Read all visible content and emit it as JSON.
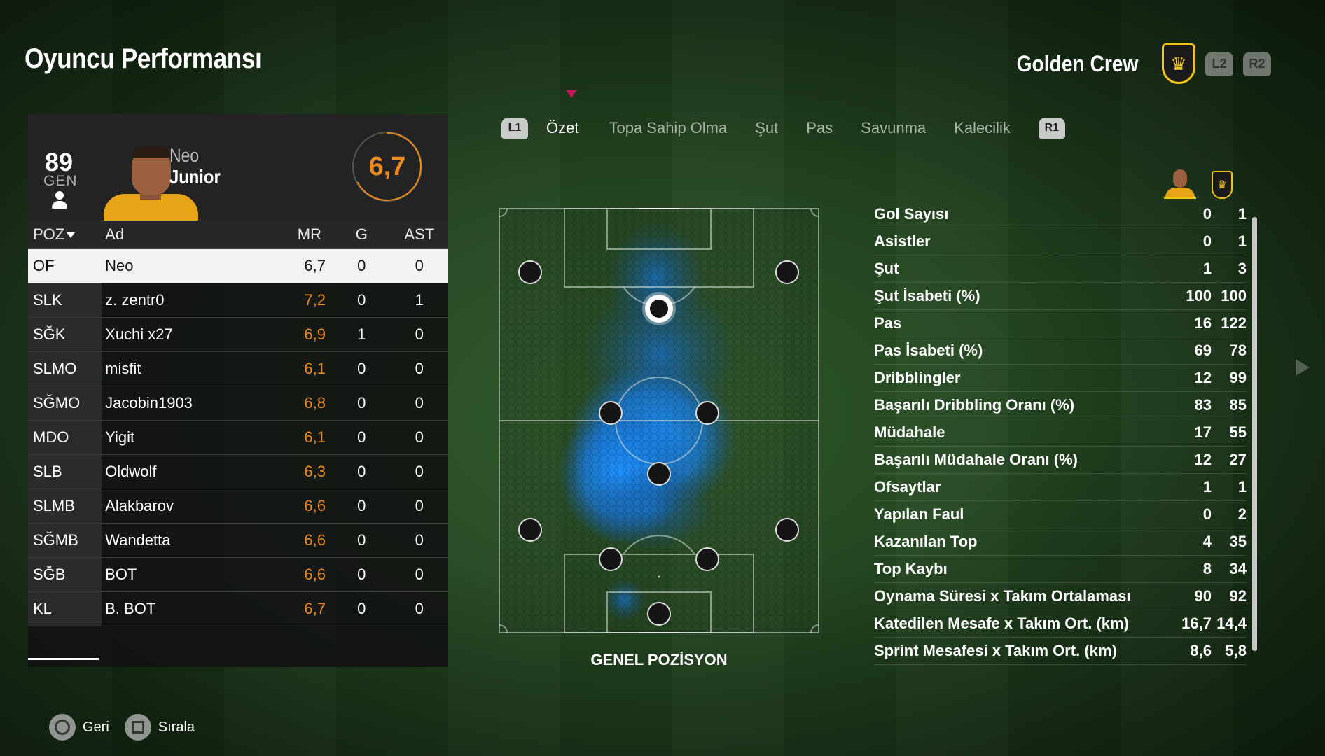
{
  "page": {
    "title": "Oyuncu Performansı"
  },
  "team": {
    "name": "Golden Crew",
    "crest_icon": "lion-crest-icon",
    "left_trigger": "L2",
    "right_trigger": "R2",
    "accent_color": "#f0c419"
  },
  "player_card": {
    "overall": "89",
    "overall_label": "GEN",
    "first_name": "Neo",
    "last_name": "Junior",
    "match_rating": "6,7",
    "match_rating_fraction": 0.67,
    "rating_color": "#f08a1a"
  },
  "table": {
    "columns": [
      "POZ",
      "Ad",
      "MR",
      "G",
      "AST"
    ],
    "rows": [
      {
        "pos": "OF",
        "name": "Neo",
        "mr": "6,7",
        "g": "0",
        "ast": "0",
        "selected": true
      },
      {
        "pos": "SLK",
        "name": "z. zentr0",
        "mr": "7,2",
        "g": "0",
        "ast": "1"
      },
      {
        "pos": "SĞK",
        "name": "Xuchi x27",
        "mr": "6,9",
        "g": "1",
        "ast": "0"
      },
      {
        "pos": "SLMO",
        "name": "misfit",
        "mr": "6,1",
        "g": "0",
        "ast": "0"
      },
      {
        "pos": "SĞMO",
        "name": "Jacobin1903",
        "mr": "6,8",
        "g": "0",
        "ast": "0"
      },
      {
        "pos": "MDO",
        "name": "Yigit",
        "mr": "6,1",
        "g": "0",
        "ast": "0"
      },
      {
        "pos": "SLB",
        "name": "Oldwolf",
        "mr": "6,3",
        "g": "0",
        "ast": "0"
      },
      {
        "pos": "SLMB",
        "name": "Alakbarov",
        "mr": "6,6",
        "g": "0",
        "ast": "0"
      },
      {
        "pos": "SĞMB",
        "name": "Wandetta",
        "mr": "6,6",
        "g": "0",
        "ast": "0"
      },
      {
        "pos": "SĞB",
        "name": "BOT",
        "mr": "6,6",
        "g": "0",
        "ast": "0"
      },
      {
        "pos": "KL",
        "name": "B. BOT",
        "mr": "6,7",
        "g": "0",
        "ast": "0"
      }
    ]
  },
  "tabs": {
    "left_shoulder": "L1",
    "right_shoulder": "R1",
    "items": [
      "Özet",
      "Topa Sahip Olma",
      "Şut",
      "Pas",
      "Savunma",
      "Kalecilik"
    ],
    "active_index": 0
  },
  "pitch": {
    "label": "GENEL POZİSYON"
  },
  "stats": {
    "rows": [
      {
        "label": "Gol Sayısı",
        "a": "0",
        "b": "1"
      },
      {
        "label": "Asistler",
        "a": "0",
        "b": "1"
      },
      {
        "label": "Şut",
        "a": "1",
        "b": "3"
      },
      {
        "label": "Şut İsabeti (%)",
        "a": "100",
        "b": "100"
      },
      {
        "label": "Pas",
        "a": "16",
        "b": "122"
      },
      {
        "label": "Pas İsabeti (%)",
        "a": "69",
        "b": "78"
      },
      {
        "label": "Dribblingler",
        "a": "12",
        "b": "99"
      },
      {
        "label": "Başarılı Dribbling Oranı (%)",
        "a": "83",
        "b": "85"
      },
      {
        "label": "Müdahale",
        "a": "17",
        "b": "55"
      },
      {
        "label": "Başarılı Müdahale Oranı (%)",
        "a": "12",
        "b": "27"
      },
      {
        "label": "Ofsaytlar",
        "a": "1",
        "b": "1"
      },
      {
        "label": "Yapılan Faul",
        "a": "0",
        "b": "2"
      },
      {
        "label": "Kazanılan Top",
        "a": "4",
        "b": "35"
      },
      {
        "label": "Top Kaybı",
        "a": "8",
        "b": "34"
      },
      {
        "label": "Oynama Süresi x Takım Ortalaması",
        "a": "90",
        "b": "92"
      },
      {
        "label": "Katedilen Mesafe x Takım Ort. (km)",
        "a": "16,7",
        "b": "14,4"
      },
      {
        "label": "Sprint Mesafesi x Takım Ort. (km)",
        "a": "8,6",
        "b": "5,8"
      }
    ]
  },
  "footer": {
    "back_label": "Geri",
    "sort_label": "Sırala"
  }
}
